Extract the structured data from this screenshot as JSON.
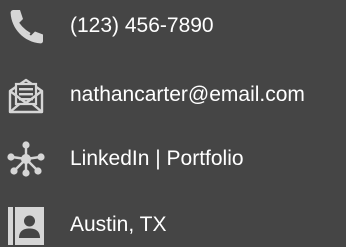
{
  "contact": {
    "phone": {
      "text": "(123) 456-7890",
      "icon": "phone-icon"
    },
    "email": {
      "text": "nathancarter@email.com",
      "icon": "envelope-icon"
    },
    "links": {
      "text": "LinkedIn | Portfolio",
      "icon": "network-icon"
    },
    "location": {
      "text": "Austin, TX",
      "icon": "contact-card-icon"
    }
  },
  "colors": {
    "background": "#454545",
    "text": "#ffffff",
    "icon": "#d6d6d6"
  }
}
